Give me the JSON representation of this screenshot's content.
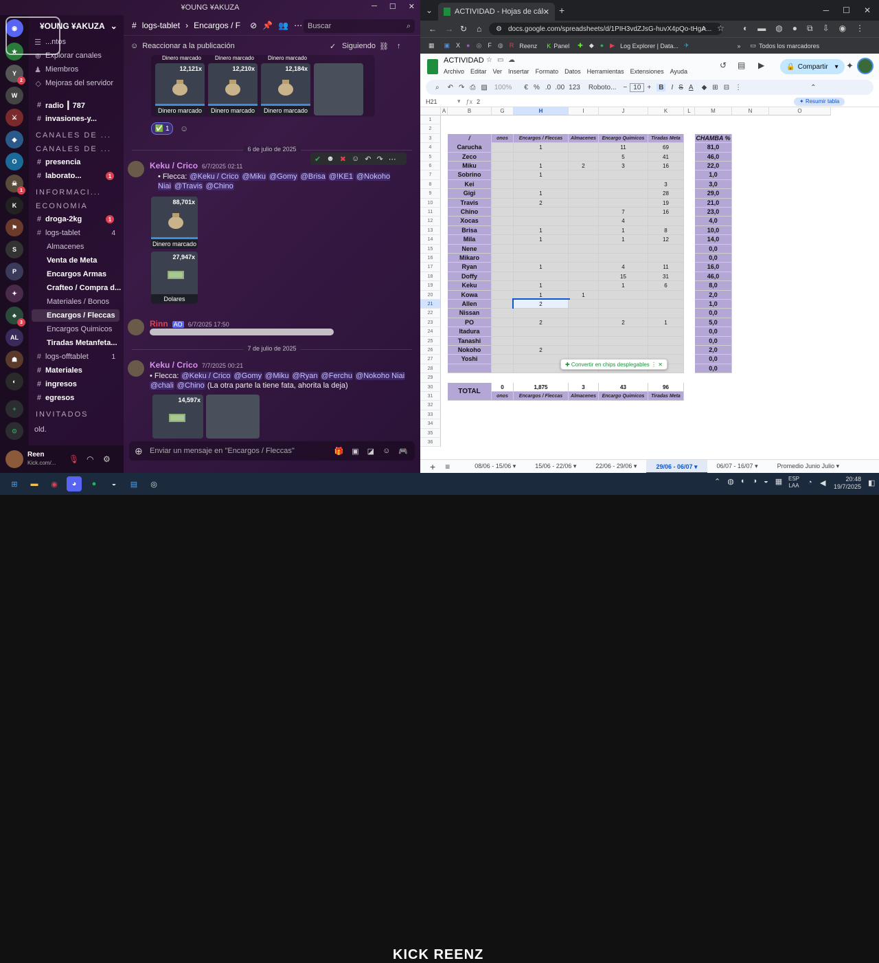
{
  "discord": {
    "title": "¥OUNG ¥AKUZA",
    "server_name": "¥OUNG ¥AKUZA",
    "channels": [
      {
        "label": "...ntos",
        "type": "top"
      },
      {
        "label": "Explorar canales",
        "type": "top"
      },
      {
        "label": "Miembros",
        "type": "top"
      },
      {
        "label": "Mejoras del servidor",
        "type": "top"
      },
      {
        "label": "radio ┃ 787",
        "type": "channel",
        "bold": true
      },
      {
        "label": "invasiones-y...",
        "type": "channel",
        "bold": true
      },
      {
        "label": "CANALES DE ...",
        "type": "category"
      },
      {
        "label": "CANALES DE ...",
        "type": "category"
      },
      {
        "label": "presencia",
        "type": "channel",
        "bold": true
      },
      {
        "label": "laborato...",
        "type": "channel",
        "bold": true,
        "badge": "1"
      },
      {
        "label": "INFORMACI...",
        "type": "category"
      },
      {
        "label": "ECONOMIA",
        "type": "category"
      },
      {
        "label": "droga-2kg",
        "type": "channel",
        "bold": true,
        "badge": "1"
      },
      {
        "label": "logs-tablet",
        "type": "channel",
        "count": "4"
      },
      {
        "label": "Almacenes",
        "type": "sub"
      },
      {
        "label": "Venta de Meta",
        "type": "sub",
        "bold": true
      },
      {
        "label": "Encargos Armas",
        "type": "sub",
        "bold": true
      },
      {
        "label": "Crafteo / Compra d...",
        "type": "sub",
        "bold": true
      },
      {
        "label": "Materiales / Bonos",
        "type": "sub"
      },
      {
        "label": "Encargos / Fleccas",
        "type": "sub",
        "selected": true
      },
      {
        "label": "Encargos Quimicos",
        "type": "sub"
      },
      {
        "label": "Tiradas Metanfeta...",
        "type": "sub",
        "bold": true
      },
      {
        "label": "logs-offtablet",
        "type": "channel",
        "count": "1"
      },
      {
        "label": "Materiales",
        "type": "channel",
        "bold": true
      },
      {
        "label": "ingresos",
        "type": "channel",
        "bold": true
      },
      {
        "label": "egresos",
        "type": "channel",
        "bold": true
      },
      {
        "label": "INVITADOS",
        "type": "category"
      },
      {
        "label": "old.",
        "type": "channel"
      }
    ],
    "user": {
      "name": "Reen",
      "status": "Kick.com/..."
    },
    "chat_header": {
      "path1": "logs-tablet",
      "path2": "Encargos / F",
      "search_placeholder": "Buscar"
    },
    "subbar": {
      "react_label": "Reaccionar a la publicación",
      "follow_label": "Siguiendo"
    },
    "top_tiles": [
      {
        "amount": "12,121x",
        "label": "Dinero marcado"
      },
      {
        "amount": "12,210x",
        "label": "Dinero marcado"
      },
      {
        "amount": "12,184x",
        "label": "Dinero marcado"
      }
    ],
    "top_tile_caption": "Dinero marcado",
    "reaction_count": "1",
    "date1": "6 de julio de 2025",
    "date2": "7 de julio de 2025",
    "msg1": {
      "author": "Keku / Crico",
      "time": "6/7/2025 02:11",
      "prefix": "Flecca:",
      "mentions": [
        "@Keku / Crico",
        "@Miku",
        "@Gomy",
        "@Brisa",
        "@!KE1",
        "@Nokoho Niai",
        "@Travis",
        "@Chino"
      ]
    },
    "msg1_tiles": [
      {
        "amount": "88,701x",
        "label": "Dinero marcado"
      },
      {
        "amount": "27,947x",
        "label": "Dolares"
      }
    ],
    "msg2": {
      "author": "Rinn",
      "badge": "AO",
      "time": "6/7/2025 17:50"
    },
    "msg3": {
      "author": "Keku / Crico",
      "time": "7/7/2025 00:21",
      "prefix": "Flecca:",
      "mentions": [
        "@Keku / Crico",
        "@Gomy",
        "@Miku",
        "@Ryan",
        "@Ferchu",
        "@Nokoho Niai",
        "@chali",
        "@Chino"
      ],
      "suffix": "(La otra parte la tiene fata, ahorita la deja)"
    },
    "msg3_tile": {
      "amount": "14,597x"
    },
    "composer_placeholder": "Enviar un mensaje en \"Encargos / Fleccas\""
  },
  "chrome": {
    "tab_title": "ACTIVIDAD - Hojas de cálculo",
    "url": "docs.google.com/spreadsheets/d/1PIH3vdZJsG-huvX4pQo-tHgA...",
    "bookmarks": [
      "Reenz",
      "Panel",
      "Log Explorer | Data...",
      "Todos los marcadores"
    ]
  },
  "sheets": {
    "doc_title": "ACTIVIDAD",
    "menu": [
      "Archivo",
      "Editar",
      "Ver",
      "Insertar",
      "Formato",
      "Datos",
      "Herramientas",
      "Extensiones",
      "Ayuda"
    ],
    "share_label": "Compartir",
    "zoom": "100%",
    "font": "Roboto...",
    "font_size": "10",
    "cell_ref": "H21",
    "formula": "2",
    "summarize_label": "Resumir tabla",
    "columns": [
      "A",
      "B",
      "G",
      "H",
      "I",
      "J",
      "K",
      "L",
      "M",
      "N",
      "O"
    ],
    "headers": [
      "/",
      "onos",
      "Encargos / Fleccas",
      "Almacenes",
      "Encargo Quimicos",
      "Tiradas Meta",
      "CHAMBA %"
    ],
    "rows": [
      {
        "name": "Carucha",
        "h": "1",
        "i": "",
        "j": "11",
        "k": "69",
        "m": "81,0"
      },
      {
        "name": "Zeco",
        "h": "",
        "i": "",
        "j": "5",
        "k": "41",
        "m": "46,0"
      },
      {
        "name": "Miku",
        "h": "1",
        "i": "2",
        "j": "3",
        "k": "16",
        "m": "22,0"
      },
      {
        "name": "Sobrino",
        "h": "1",
        "i": "",
        "j": "",
        "k": "",
        "m": "1,0"
      },
      {
        "name": "Kei",
        "h": "",
        "i": "",
        "j": "",
        "k": "3",
        "m": "3,0"
      },
      {
        "name": "Gigi",
        "h": "1",
        "i": "",
        "j": "",
        "k": "28",
        "m": "29,0"
      },
      {
        "name": "Travis",
        "h": "2",
        "i": "",
        "j": "",
        "k": "19",
        "m": "21,0"
      },
      {
        "name": "Chino",
        "h": "",
        "i": "",
        "j": "7",
        "k": "16",
        "m": "23,0"
      },
      {
        "name": "Xocas",
        "h": "",
        "i": "",
        "j": "4",
        "k": "",
        "m": "4,0"
      },
      {
        "name": "Brisa",
        "h": "1",
        "i": "",
        "j": "1",
        "k": "8",
        "m": "10,0"
      },
      {
        "name": "Mila",
        "h": "1",
        "i": "",
        "j": "1",
        "k": "12",
        "m": "14,0"
      },
      {
        "name": "Nene",
        "h": "",
        "i": "",
        "j": "",
        "k": "",
        "m": "0,0"
      },
      {
        "name": "Mikaro",
        "h": "",
        "i": "",
        "j": "",
        "k": "",
        "m": "0,0"
      },
      {
        "name": "Ryan",
        "h": "1",
        "i": "",
        "j": "4",
        "k": "11",
        "m": "16,0"
      },
      {
        "name": "Doffy",
        "h": "",
        "i": "",
        "j": "15",
        "k": "31",
        "m": "46,0"
      },
      {
        "name": "Keku",
        "h": "1",
        "i": "",
        "j": "1",
        "k": "6",
        "m": "8,0"
      },
      {
        "name": "Kowa",
        "h": "1",
        "i": "1",
        "j": "",
        "k": "",
        "m": "2,0"
      },
      {
        "name": "Allen",
        "h": "2",
        "i": "",
        "j": "",
        "k": "",
        "m": "1,0"
      },
      {
        "name": "Nissan",
        "h": "",
        "i": "",
        "j": "",
        "k": "",
        "m": "0,0"
      },
      {
        "name": "PO",
        "h": "2",
        "i": "",
        "j": "2",
        "k": "1",
        "m": "5,0"
      },
      {
        "name": "Itadura",
        "h": "",
        "i": "",
        "j": "",
        "k": "",
        "m": "0,0"
      },
      {
        "name": "Tanashi",
        "h": "",
        "i": "",
        "j": "",
        "k": "",
        "m": "0,0"
      },
      {
        "name": "Nokoho",
        "h": "2",
        "i": "",
        "j": "",
        "k": "",
        "m": "2,0"
      },
      {
        "name": "Yoshi",
        "h": "",
        "i": "",
        "j": "",
        "k": "",
        "m": "0,0"
      },
      {
        "name": "",
        "h": "",
        "i": "",
        "j": "",
        "k": "",
        "m": "0,0"
      }
    ],
    "total": {
      "label": "TOTAL",
      "g": "0",
      "h": "1,875",
      "i": "3",
      "j": "43",
      "k": "96"
    },
    "footer_labels": [
      "onos",
      "Encargos / Fleccas",
      "Almacenes",
      "Encargo Quimicos",
      "Tiradas Meta"
    ],
    "chip_label": "Convertir en chips desplegables",
    "sheet_tabs": [
      "08/06 - 15/06",
      "15/06 - 22/06",
      "22/06 - 29/06",
      "29/06 - 06/07",
      "06/07 - 16/07",
      "Promedio Junio Julio"
    ],
    "active_tab": "29/06 - 06/07"
  },
  "taskbar": {
    "stream_text": "KICK REENZ",
    "lang": "ESP",
    "lang2": "LAA",
    "time": "20:48",
    "date": "19/7/2025"
  },
  "colors": {
    "discord_bg": "#311a3c",
    "sheet_header": "#b4a7d6",
    "sheet_shade": "#d9d9d9",
    "selected": "#0b57d0"
  }
}
